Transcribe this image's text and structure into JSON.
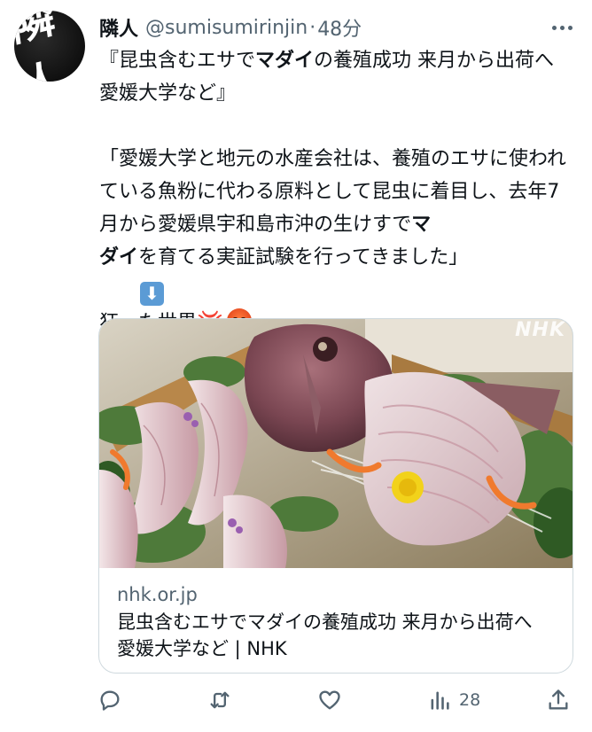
{
  "tweet": {
    "avatar_text": "隣人",
    "display_name": "隣人",
    "handle": "@sumisumirinjin",
    "separator": "·",
    "time": "48分",
    "text": {
      "line1_a": "『昆虫含むエサで",
      "line1_bold": "マダイ",
      "line1_b": "の養殖成功 来月から出荷へ 愛媛大学など』",
      "blank": "",
      "quote_a": "「愛媛大学と地元の水産会社は、養殖のエサに使われている魚粉に代わる原料として昆虫に着目し、去年7月から愛媛県宇和島市沖の生けすで",
      "quote_bold1": "マ",
      "quote_bold2": "ダイ",
      "quote_b": "を育てる実証試験を行ってきました」",
      "arrow": "⬇",
      "comment": "狂った世界",
      "anger_symbol": "💢"
    }
  },
  "card": {
    "image_label": "NHK",
    "domain": "nhk.or.jp",
    "title": "昆虫含むエサでマダイの養殖成功 来月から出荷へ 愛媛大学など | NHK"
  },
  "actions": {
    "reply_icon": "reply-icon",
    "retweet_icon": "retweet-icon",
    "like_icon": "heart-icon",
    "views_icon": "views-chart-icon",
    "views_count": "28",
    "share_icon": "share-icon"
  },
  "colors": {
    "text": "#0f1419",
    "secondary": "#536471",
    "border": "#cfd9de"
  }
}
